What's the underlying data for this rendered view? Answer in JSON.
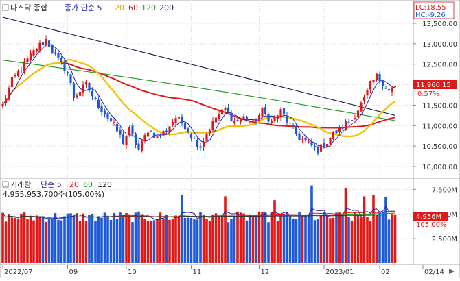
{
  "chart_data": [
    {
      "type": "candlestick",
      "title": "나스닥 종합",
      "legend": {
        "prefix": "종가 단순 5",
        "periods": [
          "20",
          "60",
          "120",
          "200"
        ],
        "colors": {
          "5": "#1e1ea8",
          "20": "#f2c20c",
          "60": "#e01818",
          "120": "#1a9a1a",
          "200": "#14144e"
        }
      },
      "corner": {
        "lc": "LC:18.55",
        "hc": "HC:-9.26"
      },
      "last": {
        "price_label": "11,960.15",
        "change_label": "0.57%",
        "value": 11960.15
      },
      "y_axis": {
        "ylim": [
          9850,
          13700
        ],
        "ticks": [
          {
            "v": 10000,
            "label": "10,000.00"
          },
          {
            "v": 10500,
            "label": "10,500.00"
          },
          {
            "v": 11000,
            "label": "11,000.00"
          },
          {
            "v": 11500,
            "label": "11,500.00"
          },
          {
            "v": 12000,
            "label": "12,000.00"
          },
          {
            "v": 12500,
            "label": "12,500.00"
          },
          {
            "v": 13000,
            "label": "13,000.00"
          },
          {
            "v": 13500,
            "label": "13,500.00"
          }
        ]
      },
      "x_axis": {
        "bars": 128,
        "ticks": [
          {
            "i": 0,
            "label": "2022/07"
          },
          {
            "i": 21,
            "label": "09"
          },
          {
            "i": 40,
            "label": "10"
          },
          {
            "i": 61,
            "label": "11"
          },
          {
            "i": 83,
            "label": "12"
          },
          {
            "i": 104,
            "label": "2023/01"
          },
          {
            "i": 122,
            "label": "02"
          },
          {
            "i": 142,
            "label": "02/14"
          }
        ]
      },
      "close_anchors": [
        [
          0,
          11500
        ],
        [
          3,
          12100
        ],
        [
          7,
          12500
        ],
        [
          11,
          12900
        ],
        [
          14,
          13100
        ],
        [
          17,
          12700
        ],
        [
          21,
          12300
        ],
        [
          23,
          11700
        ],
        [
          27,
          12000
        ],
        [
          30,
          11600
        ],
        [
          33,
          11300
        ],
        [
          36,
          11000
        ],
        [
          39,
          10600
        ],
        [
          41,
          10900
        ],
        [
          44,
          10400
        ],
        [
          47,
          10900
        ],
        [
          50,
          10700
        ],
        [
          53,
          10900
        ],
        [
          56,
          11200
        ],
        [
          59,
          11000
        ],
        [
          62,
          10650
        ],
        [
          64,
          10500
        ],
        [
          66,
          10800
        ],
        [
          69,
          11200
        ],
        [
          72,
          11400
        ],
        [
          75,
          11100
        ],
        [
          78,
          11200
        ],
        [
          81,
          11050
        ],
        [
          84,
          11350
        ],
        [
          87,
          11100
        ],
        [
          90,
          11350
        ],
        [
          93,
          11000
        ],
        [
          96,
          10700
        ],
        [
          99,
          10550
        ],
        [
          102,
          10400
        ],
        [
          105,
          10600
        ],
        [
          107,
          10800
        ],
        [
          109,
          10900
        ],
        [
          111,
          11050
        ],
        [
          113,
          11150
        ],
        [
          115,
          11400
        ],
        [
          117,
          11650
        ],
        [
          119,
          12000
        ],
        [
          121,
          12200
        ],
        [
          123,
          12050
        ],
        [
          125,
          11850
        ],
        [
          127,
          11960
        ]
      ]
    },
    {
      "type": "bar",
      "title": "거래량",
      "legend": {
        "prefix": "단순 5",
        "periods": [
          "20",
          "60",
          "120"
        ]
      },
      "info": "4,955,953,700주(105.00%)",
      "current": {
        "label": "4,956M",
        "pct": "105.00%",
        "value": 4956
      },
      "y_axis": {
        "ylim": [
          0,
          8500
        ],
        "ticks": [
          {
            "v": 2500,
            "label": "2,500M"
          },
          {
            "v": 5000,
            "label": "5,000M"
          },
          {
            "v": 7500,
            "label": "7,500M"
          }
        ]
      },
      "volume_base_m": 4700,
      "volume_spikes_m": [
        [
          58,
          6950
        ],
        [
          72,
          6800
        ],
        [
          88,
          6400
        ],
        [
          100,
          7900
        ],
        [
          111,
          7650
        ],
        [
          117,
          6800
        ],
        [
          120,
          6900
        ],
        [
          124,
          6700
        ]
      ]
    }
  ]
}
